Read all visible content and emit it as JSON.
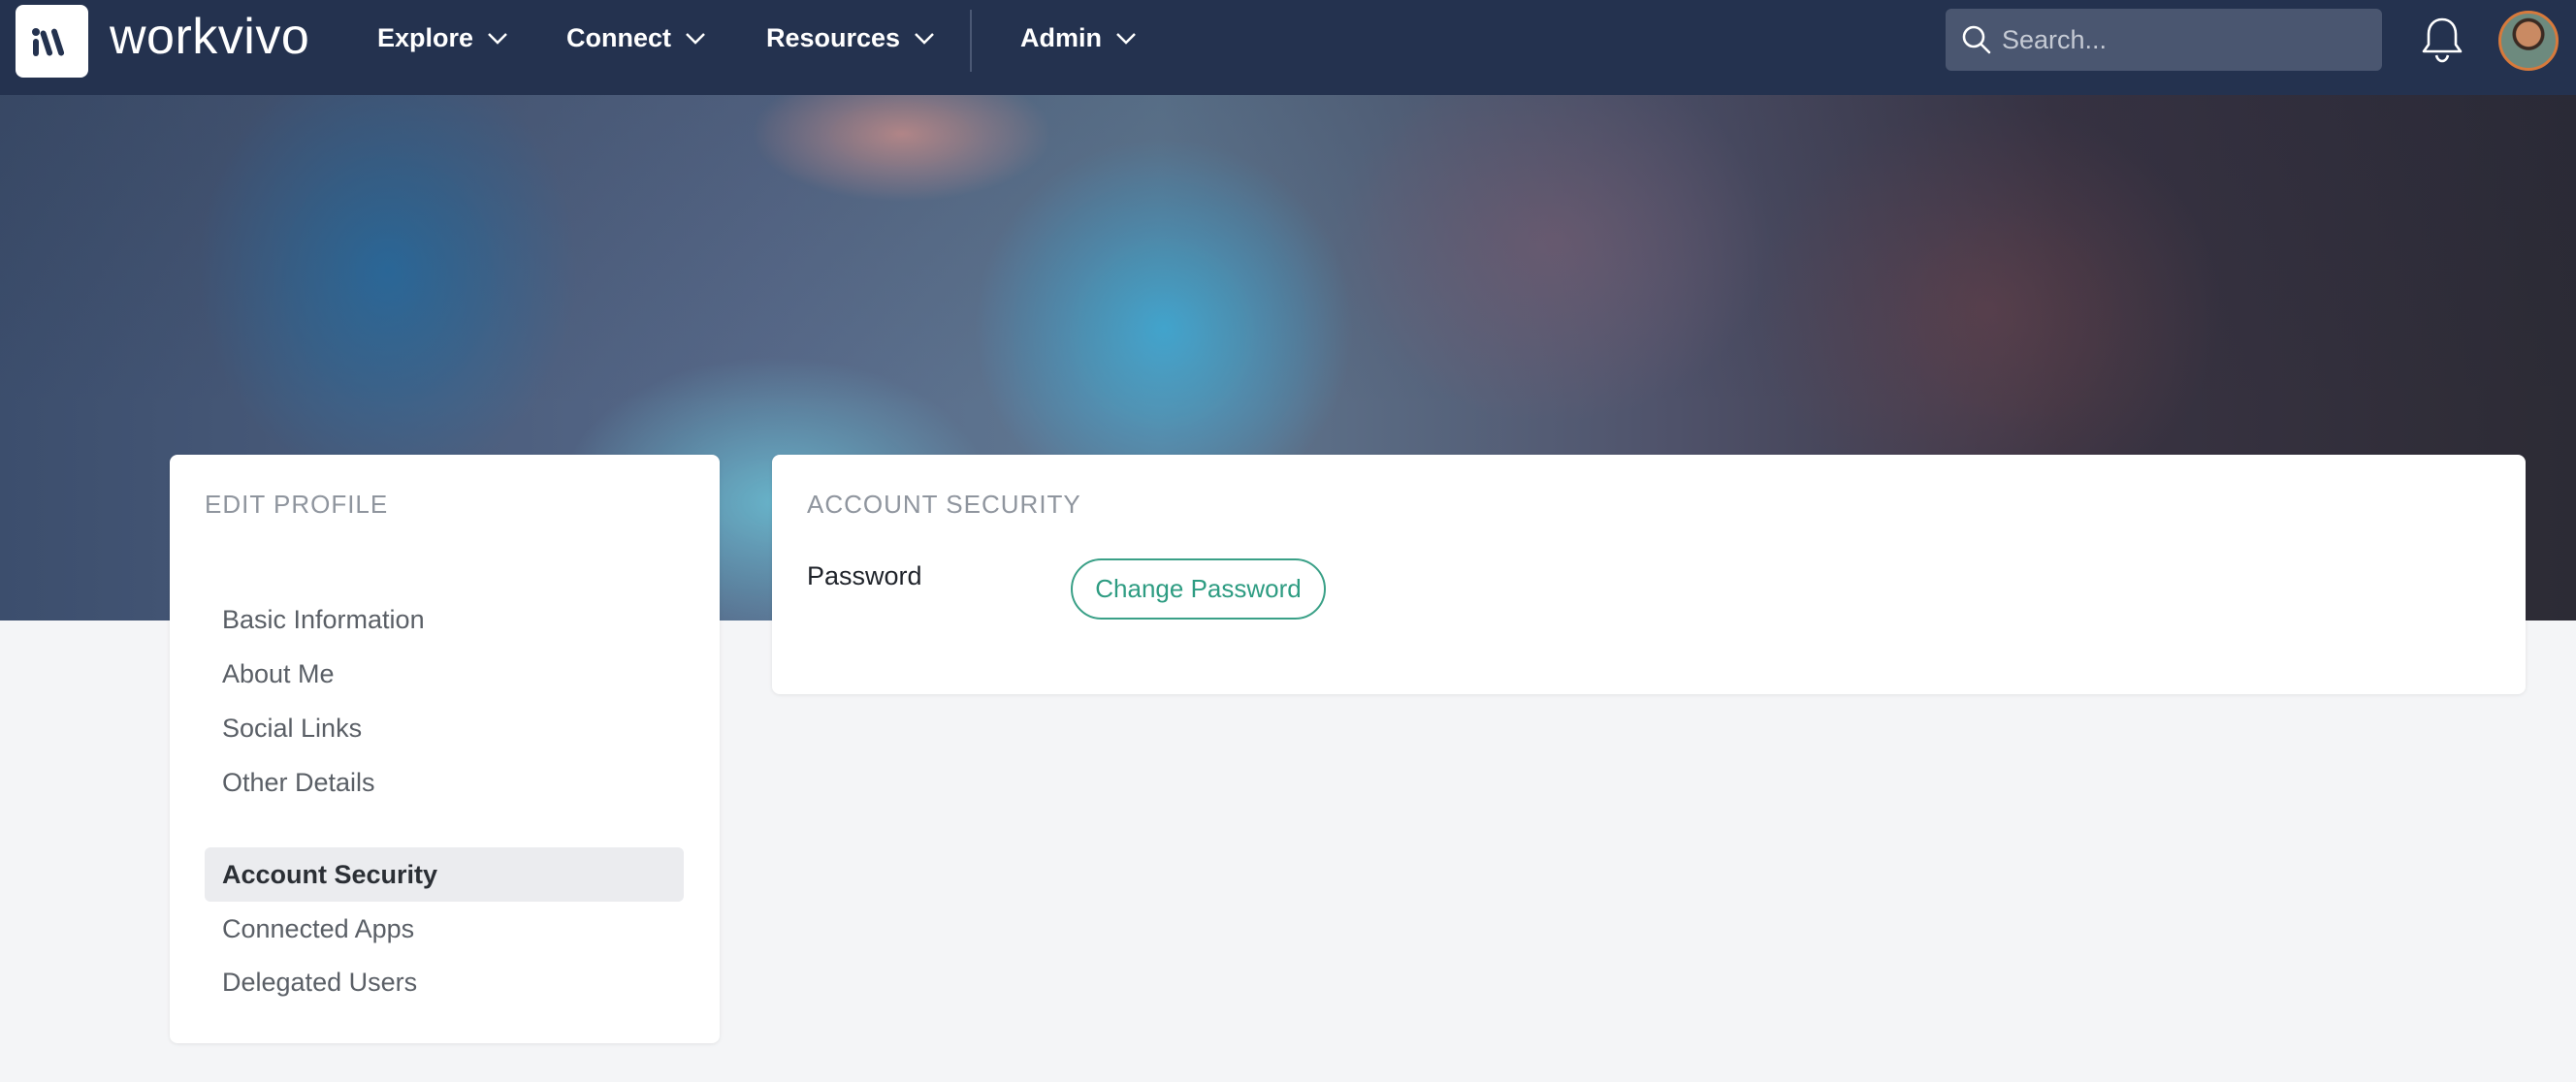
{
  "topbar": {
    "brand": "workvivo",
    "nav": [
      {
        "label": "Explore"
      },
      {
        "label": "Connect"
      },
      {
        "label": "Resources"
      },
      {
        "label": "Admin"
      }
    ],
    "search_placeholder": "Search..."
  },
  "edit_profile": {
    "heading": "EDIT PROFILE",
    "items": [
      {
        "label": "Basic Information"
      },
      {
        "label": "About Me"
      },
      {
        "label": "Social Links"
      },
      {
        "label": "Other Details"
      },
      {
        "label": "Account Security"
      },
      {
        "label": "Connected Apps"
      },
      {
        "label": "Delegated Users"
      }
    ],
    "active_item": "Account Security"
  },
  "account_security": {
    "heading": "ACCOUNT SECURITY",
    "password_label": "Password",
    "change_password_button": "Change Password"
  },
  "colors": {
    "topbar": "#24324f",
    "accent": "#2e9c82"
  }
}
